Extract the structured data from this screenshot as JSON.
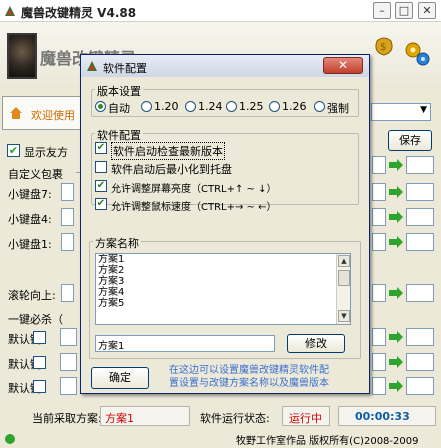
{
  "window": {
    "title": "魔兽改键精灵 V4.88",
    "minimize_label": "–",
    "restore_label": "□",
    "close_label": "✕"
  },
  "banner": {
    "text": "魔兽改键精灵"
  },
  "left_panel": {
    "welcome_tab": "欢迎使用",
    "show_friends": "显示友方",
    "custom_package": "自定义包裹",
    "keypad7": "小键盘7:",
    "keypad4": "小键盘4:",
    "keypad1": "小键盘1:",
    "wheel_up": "滚轮向上:",
    "one_key_cast": "一键必杀（",
    "default_key": "默认键:"
  },
  "right_panel": {
    "save_label": "保存"
  },
  "dialog": {
    "title": "软件配置",
    "close_label": "✕",
    "version_group": "版本设置",
    "version_options": [
      "自动",
      "1.20",
      "1.24",
      "1.25",
      "1.26",
      "强制"
    ],
    "selected_version": "自动",
    "software_group": "软件配置",
    "options": [
      {
        "label": "软件启动检查最新版本",
        "checked": true
      },
      {
        "label": "软件启动后最小化到托盘",
        "checked": false
      },
      {
        "label": "允许调整屏幕亮度（CTRL+↑ ~ ↓）",
        "checked": true
      },
      {
        "label": "允许调整鼠标速度（CTRL+→ ~ ←）",
        "checked": true
      }
    ],
    "scheme_group": "方案名称",
    "schemes": [
      "方案1",
      "方案2",
      "方案3",
      "方案4",
      "方案5"
    ],
    "scheme_input": "方案1",
    "modify_label": "修改",
    "ok_label": "确定",
    "note_line1": "在这边可以设置魔兽改键精灵软件配",
    "note_line2": "置设置与改键方案名称以及魔兽版本"
  },
  "status": {
    "current_scheme_label": "当前采取方案:",
    "current_scheme_value": "方案1",
    "run_state_label": "软件运行状态:",
    "run_state_value": "运行中",
    "timer": "00:00:33"
  },
  "footer": {
    "credit": "牧野工作室作品 版权所有(C)2008-2009"
  },
  "colors": {
    "accent_green": "#2ea42e",
    "status_red": "#d00000",
    "timer_blue": "#0b5ea8",
    "note_blue": "#3a6fd0"
  }
}
